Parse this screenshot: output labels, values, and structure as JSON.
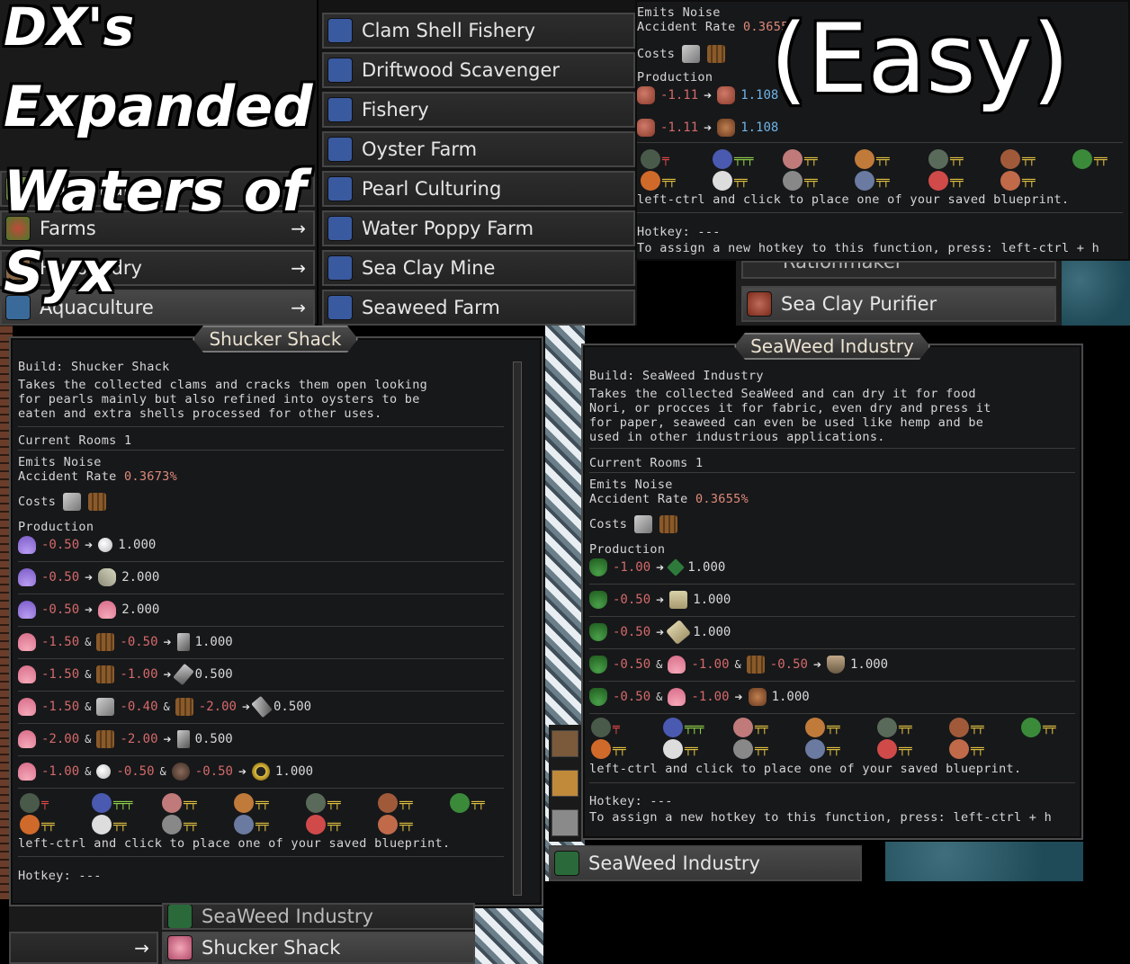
{
  "overlay": {
    "title_lines": [
      "DX's",
      "Expanded",
      "Waters of",
      "Syx"
    ],
    "easy": "(Easy)"
  },
  "category_menu": {
    "items": [
      {
        "label": "Husbandry",
        "icon": "animal-icon"
      },
      {
        "label": "Farms",
        "icon": "farm-icon",
        "arrow": "→"
      },
      {
        "label": "Husbandry",
        "icon": "animal-icon",
        "arrow": "→"
      },
      {
        "label": "Aquaculture",
        "icon": "aquaculture-icon",
        "arrow": "→"
      }
    ]
  },
  "aquaculture_menu": {
    "items": [
      {
        "label": "Clam Shell Fishery",
        "icon": "clam-shell-icon"
      },
      {
        "label": "Driftwood Scavenger",
        "icon": "driftwood-icon"
      },
      {
        "label": "Fishery",
        "icon": "fish-icon"
      },
      {
        "label": "Oyster Farm",
        "icon": "oyster-icon"
      },
      {
        "label": "Pearl Culturing",
        "icon": "pearl-icon"
      },
      {
        "label": "Water Poppy Farm",
        "icon": "water-poppy-icon"
      },
      {
        "label": "Sea Clay Mine",
        "icon": "sea-clay-icon"
      },
      {
        "label": "Seaweed Farm",
        "icon": "seaweed-icon"
      }
    ]
  },
  "top_tooltip": {
    "emits": "Emits Noise",
    "accident_label": "Accident Rate",
    "accident_value": "0.3655",
    "costs_label": "Costs",
    "production_label": "Production",
    "rows": [
      {
        "in": "-1.11",
        "out": "1.108"
      },
      {
        "in": "-1.11",
        "out": "1.108"
      }
    ],
    "blueprint_hint": "left-ctrl and click to place one of your saved blueprint.",
    "hotkey": "Hotkey: ---",
    "assign_hint": "To assign a new hotkey to this function, press: left-ctrl + h"
  },
  "right_menu": {
    "partial_item": "Rationmaker",
    "sea_clay_purifier": "Sea Clay Purifier"
  },
  "shucker_panel": {
    "title": "Shucker Shack",
    "build": "Build: Shucker Shack",
    "desc_lines": [
      "Takes the collected clams and cracks them open looking",
      "for pearls mainly but also refined into oysters to be",
      "eaten and extra shells processed for other uses."
    ],
    "current_rooms": "Current Rooms 1",
    "emits": "Emits Noise",
    "accident_label": "Accident Rate",
    "accident_value": "0.3673%",
    "costs_label": "Costs",
    "production_label": "Production",
    "rows": [
      {
        "inputs": [
          {
            "icon": "shell-purple",
            "v": "-0.50"
          }
        ],
        "out_icon": "pearl",
        "out": "1.000"
      },
      {
        "inputs": [
          {
            "icon": "shell-purple",
            "v": "-0.50"
          }
        ],
        "out_icon": "oyster",
        "out": "2.000"
      },
      {
        "inputs": [
          {
            "icon": "shell-purple",
            "v": "-0.50"
          }
        ],
        "out_icon": "shell-pink",
        "out": "2.000"
      },
      {
        "inputs": [
          {
            "icon": "shell-pink",
            "v": "-1.50"
          },
          {
            "icon": "wood",
            "v": "-0.50"
          }
        ],
        "out_icon": "tool",
        "out": "1.000"
      },
      {
        "inputs": [
          {
            "icon": "shell-pink",
            "v": "-1.50"
          },
          {
            "icon": "wood",
            "v": "-1.00"
          }
        ],
        "out_icon": "tool",
        "out": "0.500"
      },
      {
        "inputs": [
          {
            "icon": "shell-pink",
            "v": "-1.50"
          },
          {
            "icon": "stone",
            "v": "-0.40"
          },
          {
            "icon": "wood",
            "v": "-2.00"
          }
        ],
        "out_icon": "tool",
        "out": "0.500"
      },
      {
        "inputs": [
          {
            "icon": "shell-pink",
            "v": "-2.00"
          },
          {
            "icon": "wood",
            "v": "-2.00"
          }
        ],
        "out_icon": "tool",
        "out": "0.500"
      },
      {
        "inputs": [
          {
            "icon": "shell-pink",
            "v": "-1.00"
          },
          {
            "icon": "pearl",
            "v": "-0.50"
          },
          {
            "icon": "coal",
            "v": "-0.50"
          }
        ],
        "out_icon": "ring",
        "out": "1.000"
      }
    ],
    "blueprint_hint": "left-ctrl and click to place one of your saved blueprint.",
    "hotkey": "Hotkey: ---"
  },
  "seaweed_panel": {
    "title": "SeaWeed Industry",
    "build": "Build: SeaWeed Industry",
    "desc_lines": [
      "Takes the collected SeaWeed and can dry it for food",
      "Nori, or procces it for fabric, even dry and press it",
      "for paper, seaweed can even be used like hemp and be",
      "used in other industrious applications."
    ],
    "current_rooms": "Current Rooms 1",
    "emits": "Emits Noise",
    "accident_label": "Accident Rate",
    "accident_value": "0.3655%",
    "costs_label": "Costs",
    "production_label": "Production",
    "rows": [
      {
        "inputs": [
          {
            "icon": "weed",
            "v": "-1.00"
          }
        ],
        "out_icon": "weed-dry",
        "out": "1.000"
      },
      {
        "inputs": [
          {
            "icon": "weed",
            "v": "-0.50"
          }
        ],
        "out_icon": "paper",
        "out": "1.000"
      },
      {
        "inputs": [
          {
            "icon": "weed",
            "v": "-0.50"
          }
        ],
        "out_icon": "tool",
        "out": "1.000"
      },
      {
        "inputs": [
          {
            "icon": "weed",
            "v": "-0.50"
          },
          {
            "icon": "shell-pink",
            "v": "-1.00"
          },
          {
            "icon": "wood",
            "v": "-0.50"
          }
        ],
        "out_icon": "shield",
        "out": "1.000"
      },
      {
        "inputs": [
          {
            "icon": "weed",
            "v": "-0.50"
          },
          {
            "icon": "shell-pink",
            "v": "-1.00"
          }
        ],
        "out_icon": "armor",
        "out": "1.000"
      }
    ],
    "blueprint_hint": "left-ctrl and click to place one of your saved blueprint.",
    "hotkey": "Hotkey: ---",
    "assign_hint": "To assign a new hotkey to this function, press: left-ctrl + h"
  },
  "bottom_menu": {
    "seaweed_industry": "SeaWeed Industry",
    "shucker_shack": "Shucker Shack",
    "arrow": "→",
    "right_item": "SeaWeed Industry"
  },
  "colors": {
    "negative": "#d46a6a",
    "positive": "#6fb3e6",
    "accent_green": "#8fd04a"
  }
}
